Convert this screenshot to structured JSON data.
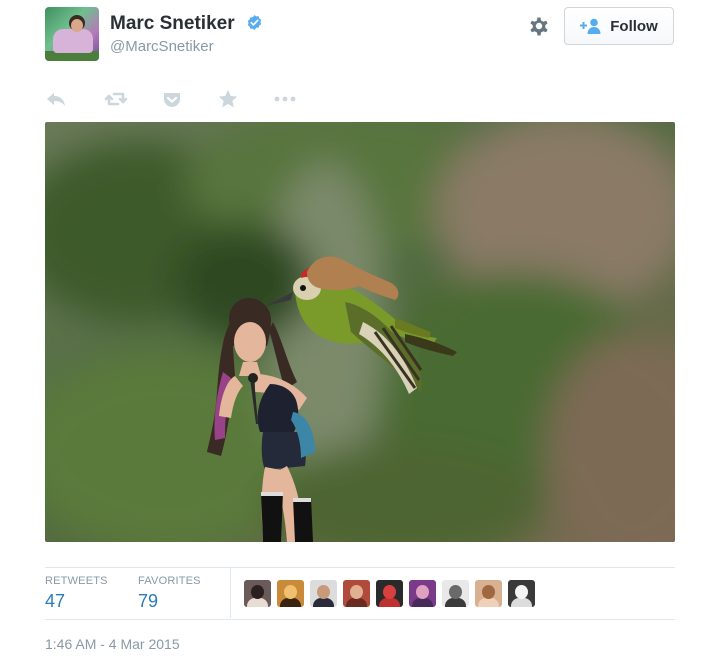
{
  "tweet": {
    "author": {
      "name": "Marc Snetiker",
      "handle": "@MarcSnetiker",
      "verified": true
    },
    "follow_label": "Follow",
    "actions": [
      {
        "name": "reply-icon"
      },
      {
        "name": "retweet-icon"
      },
      {
        "name": "pocket-icon"
      },
      {
        "name": "favorite-star-icon"
      },
      {
        "name": "more-dots-icon"
      }
    ],
    "stats": {
      "retweets_label": "RETWEETS",
      "retweets_count": "47",
      "favorites_label": "FAVORITES",
      "favorites_count": "79"
    },
    "timestamp": "1:46 AM - 4 Mar 2015"
  },
  "colors": {
    "link_blue": "#2b7bb9",
    "verified_blue": "#55acee",
    "muted_gray": "#8899a6",
    "text_dark": "#292f33"
  }
}
